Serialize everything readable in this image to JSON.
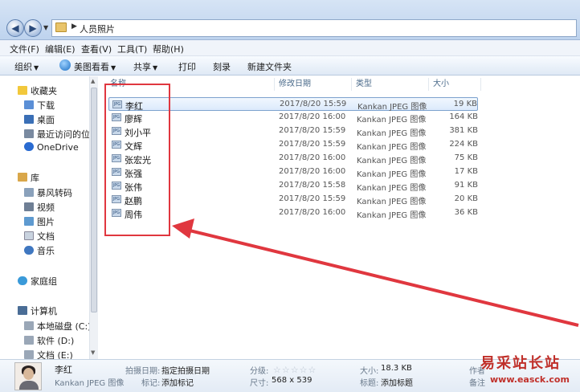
{
  "address": {
    "path": "人员照片"
  },
  "menu": [
    "文件(F)",
    "编辑(E)",
    "查看(V)",
    "工具(T)",
    "帮助(H)"
  ],
  "toolbar": {
    "organize": "组织",
    "view_with": "美图看看",
    "share": "共享",
    "print": "打印",
    "burn": "刻录",
    "new_folder": "新建文件夹"
  },
  "nav": {
    "favorites": "收藏夹",
    "downloads": "下载",
    "desktop": "桌面",
    "recent": "最近访问的位置",
    "onedrive": "OneDrive",
    "libraries": "库",
    "baofeng": "暴风转码",
    "videos": "视频",
    "pictures": "图片",
    "documents": "文档",
    "music": "音乐",
    "homegroup": "家庭组",
    "computer": "计算机",
    "drive_c": "本地磁盘 (C:)",
    "drive_d": "软件 (D:)",
    "drive_e": "文档 (E:)"
  },
  "columns": {
    "name": "名称",
    "date": "修改日期",
    "type": "类型",
    "size": "大小"
  },
  "files": [
    {
      "name": "李红",
      "date": "2017/8/20 15:59",
      "type": "Kankan JPEG 图像",
      "size": "19 KB"
    },
    {
      "name": "廖辉",
      "date": "2017/8/20 16:00",
      "type": "Kankan JPEG 图像",
      "size": "164 KB"
    },
    {
      "name": "刘小平",
      "date": "2017/8/20 15:59",
      "type": "Kankan JPEG 图像",
      "size": "381 KB"
    },
    {
      "name": "文辉",
      "date": "2017/8/20 15:59",
      "type": "Kankan JPEG 图像",
      "size": "224 KB"
    },
    {
      "name": "张宏光",
      "date": "2017/8/20 16:00",
      "type": "Kankan JPEG 图像",
      "size": "75 KB"
    },
    {
      "name": "张强",
      "date": "2017/8/20 16:00",
      "type": "Kankan JPEG 图像",
      "size": "17 KB"
    },
    {
      "name": "张伟",
      "date": "2017/8/20 15:58",
      "type": "Kankan JPEG 图像",
      "size": "91 KB"
    },
    {
      "name": "赵鹏",
      "date": "2017/8/20 15:59",
      "type": "Kankan JPEG 图像",
      "size": "20 KB"
    },
    {
      "name": "周伟",
      "date": "2017/8/20 16:00",
      "type": "Kankan JPEG 图像",
      "size": "36 KB"
    }
  ],
  "details": {
    "name": "李红",
    "type": "Kankan JPEG 图像",
    "date_taken_label": "拍摄日期:",
    "date_taken_value": "指定拍摄日期",
    "tags_label": "标记:",
    "tags_value": "添加标记",
    "rating_label": "分级:",
    "dimensions_label": "尺寸:",
    "dimensions_value": "568 x 539",
    "size_label": "大小:",
    "size_value": "18.3 KB",
    "title_label": "标题:",
    "title_value": "添加标题",
    "author_label": "作者",
    "notes_label": "备注"
  },
  "watermark": {
    "text": "易采站长站",
    "url": "www.easck.com"
  },
  "colors": {
    "annotation": "#e0373f",
    "selection_border": "#7da2ce"
  }
}
